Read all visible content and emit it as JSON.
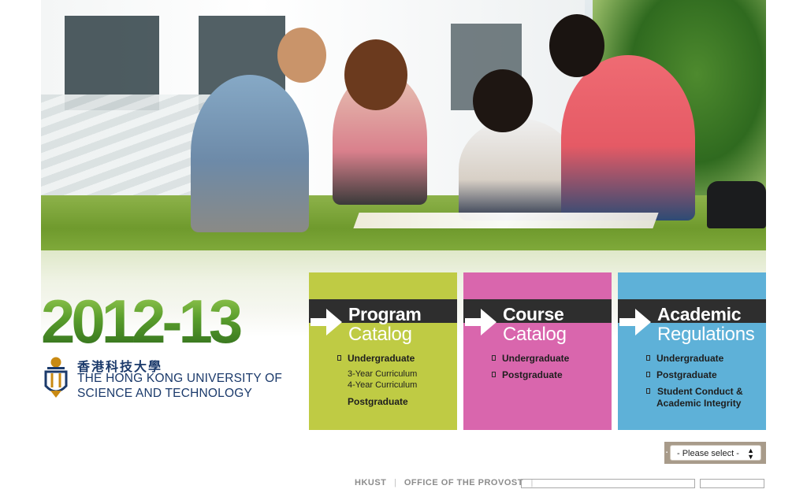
{
  "year": "2012-13",
  "logo": {
    "chinese_name": "香港科技大學",
    "english_line1": "THE HONG KONG UNIVERSITY OF",
    "english_line2": "SCIENCE AND TECHNOLOGY"
  },
  "panels": [
    {
      "title": "Program",
      "subtitle": "Catalog",
      "color": "#bfcb44",
      "links": [
        "Undergraduate",
        "3-Year Curriculum",
        "4-Year Curriculum",
        "Postgraduate"
      ]
    },
    {
      "title": "Course",
      "subtitle": "Catalog",
      "color": "#d966ad",
      "links": [
        "Undergraduate",
        "Postgraduate"
      ]
    },
    {
      "title": "Academic",
      "subtitle": "Regulations",
      "color": "#5eb1d8",
      "links": [
        "Undergraduate",
        "Postgraduate",
        "Student Conduct &",
        "Academic Integrity"
      ]
    }
  ],
  "select": {
    "value": "- Please select -"
  },
  "footer": {
    "link1": "HKUST",
    "separator": "|",
    "link2": "OFFICE OF THE PROVOST"
  }
}
